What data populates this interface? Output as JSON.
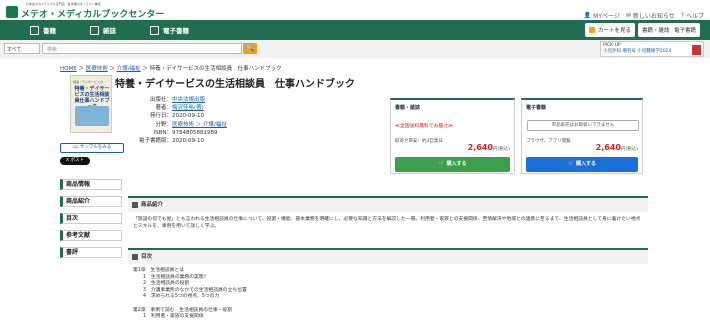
{
  "header": {
    "small_text": "日本最大のメディカル専門店・医学書のオンライン書店",
    "logo": "メテオ・メディカルブックセンター",
    "links": [
      "MYページ",
      "新しいお知らせ",
      "ヘルプ"
    ]
  },
  "nav": {
    "items": [
      "書籍",
      "雑誌",
      "電子書籍"
    ],
    "cart": "カートを見る",
    "buttons": [
      "書籍・雑誌",
      "電子書籍"
    ]
  },
  "search": {
    "category": "すべて",
    "placeholder": "検索",
    "button": "🔍"
  },
  "pickup": {
    "label": "PICK UP",
    "text": "小児外科 増刊号 小児腫瘍学2024"
  },
  "breadcrumb": [
    "HOME",
    "医療技術",
    "介護/福祉",
    "特養・デイサービスの生活相談員　仕事ハンドブック"
  ],
  "book": {
    "title": "特養・デイサービスの生活相談員　仕事ハンドブック",
    "cover_small": "特養・デイサービスの",
    "cover_title": "特養・デイサービスの生活相談員仕事ハンドブック",
    "sample": "サンプルをみる",
    "xpost": "ポスト",
    "info": [
      {
        "k": "出版社：",
        "v": "中央法規出版",
        "link": true
      },
      {
        "k": "著者：",
        "v": "梅沢佳裕(著)",
        "link": true
      },
      {
        "k": "発行日：",
        "v": "2020-09-10",
        "link": false
      },
      {
        "k": "分野：",
        "v": "医療技術 ＞ 介護/福祉",
        "link": true
      },
      {
        "k": "ISBN：",
        "v": "9784805881989",
        "link": false
      },
      {
        "k": "電子書籍版：",
        "v": "2020-09-10",
        "link": false
      }
    ]
  },
  "purchase": {
    "print": {
      "head": "書籍・雑誌",
      "notice": "≪全国送料無料でお届け≫",
      "ship": "取寄せ目安：約3営業日",
      "price": "2,640",
      "unit": "円(税込)",
      "buy": "購入する"
    },
    "ebook": {
      "head": "電子書籍",
      "notice": "単品販売はお取扱いできません",
      "browser": "ブラウザ、アプリ閲覧",
      "price": "2,640",
      "unit": "円(税込)",
      "buy": "購入する"
    }
  },
  "sidebar": [
    "商品情報",
    "商品紹介",
    "目次",
    "参考文献",
    "書評"
  ],
  "intro": {
    "head": "商品紹介",
    "text": "「施設の何でも屋」とも言われる生活相談員の仕事について、役割・機能、基本業務を明確にし、必要な知識と方法を解説した一冊。利用者・家族との支援関係、苦情解決や地域との連携に至るまで、生活相談員として身に着けたい視点とスキルを、事例を用いて詳しく学ぶ。"
  },
  "toc": {
    "head": "目次",
    "lines": [
      "第1章　生活相談員とは",
      "1　生活相談員の業務の実態？",
      "2　生活相談員の役割",
      "3　介護事業所のなかでの生活相談員の立ち位置",
      "4　求められる5つの視点、5つの力",
      "",
      "第2章　事例で読む　生活相談員の仕事・役割",
      "1　利用者・家族の支援関係"
    ]
  }
}
